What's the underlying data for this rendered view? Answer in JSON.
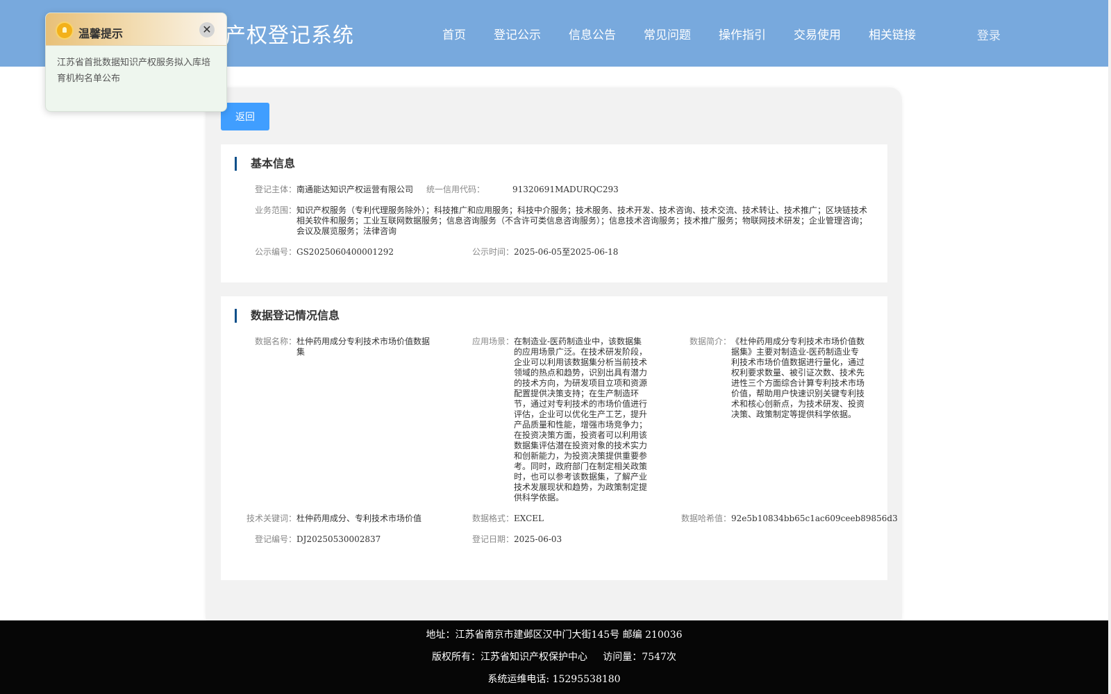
{
  "header": {
    "site_title": "产权登记系统",
    "nav": [
      "首页",
      "登记公示",
      "信息公告",
      "常见问题",
      "操作指引",
      "交易使用",
      "相关链接"
    ],
    "login": "登录"
  },
  "toast": {
    "title": "温馨提示",
    "close_symbol": "✕",
    "message": "江苏省首批数据知识产权服务拟入库培育机构名单公布"
  },
  "back_label": "返回",
  "basic_info": {
    "title": "基本信息",
    "subject_label": "登记主体：",
    "subject": "南通能达知识产权运营有限公司",
    "credit_code_label": "统一信用代码：",
    "credit_code": "91320691MADURQC293",
    "scope_label": "业务范围：",
    "scope": "知识产权服务（专利代理服务除外）；科技推广和应用服务；科技中介服务；技术服务、技术开发、技术咨询、技术交流、技术转让、技术推广；区块链技术相关软件和服务；工业互联网数据服务；信息咨询服务（不含许可类信息咨询服务）；信息技术咨询服务；技术推广服务；物联网技术研发；企业管理咨询；会议及展览服务；法律咨询",
    "notice_no_label": "公示编号：",
    "notice_no": "GS2025060400001292",
    "notice_time_label": "公示时间：",
    "notice_time": "2025-06-05至2025-06-18"
  },
  "data_info": {
    "title": "数据登记情况信息",
    "name_label": "数据名称：",
    "name": "杜仲药用成分专利技术市场价值数据集",
    "scenario_label": "应用场景：",
    "scenario": "在制造业-医药制造业中，该数据集的应用场景广泛。在技术研发阶段，企业可以利用该数据集分析当前技术领域的热点和趋势，识别出具有潜力的技术方向，为研发项目立项和资源配置提供决策支持；在生产制造环节，通过对专利技术的市场价值进行评估，企业可以优化生产工艺，提升产品质量和性能，增强市场竞争力；在投资决策方面，投资者可以利用该数据集评估潜在投资对象的技术实力和创新能力，为投资决策提供重要参考。同时，政府部门在制定相关政策时，也可以参考该数据集，了解产业技术发展现状和趋势，为政策制定提供科学依据。",
    "intro_label": "数据简介：",
    "intro": "《杜仲药用成分专利技术市场价值数据集》主要对制造业-医药制造业专利技术市场价值数据进行量化，通过权利要求数量、被引证次数、技术先进性三个方面综合计算专利技术市场价值，帮助用户快速识别关键专利技术和核心创新点，为技术研发、投资决策、政策制定等提供科学依据。",
    "keywords_label": "技术关键词：",
    "keywords": "杜仲药用成分、专利技术市场价值",
    "format_label": "数据格式：",
    "format": "EXCEL",
    "hash_label": "数据哈希值：",
    "hash": "92e5b10834bb65c1ac609ceeb89856d3",
    "reg_no_label": "登记编号：",
    "reg_no": "DJ20250530002837",
    "reg_date_label": "登记日期：",
    "reg_date": "2025-06-03"
  },
  "footer": {
    "address": "地址：江苏省南京市建邺区汉中门大街145号 邮编 210036",
    "copyright": "版权所有：江苏省知识产权保护中心     访问量：7547次",
    "hotline": "系统运维电话: 15295538180"
  }
}
